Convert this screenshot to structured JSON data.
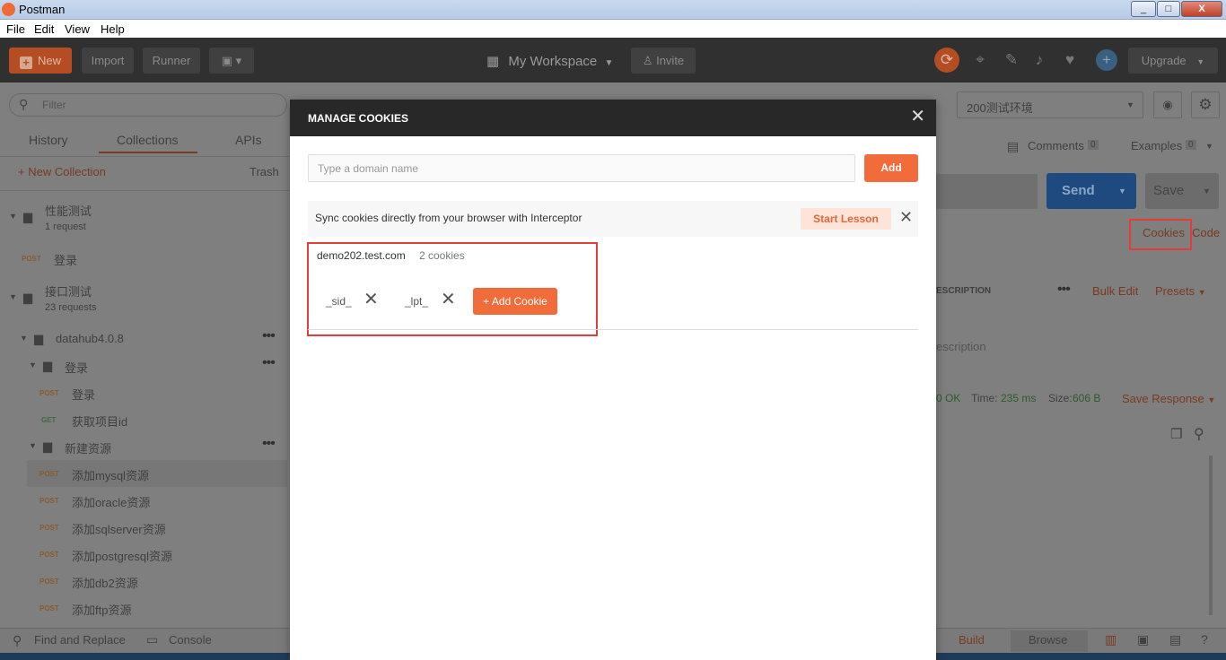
{
  "window": {
    "title": "Postman",
    "min": "_",
    "max": "□",
    "close": "X"
  },
  "menu": [
    "File",
    "Edit",
    "View",
    "Help"
  ],
  "header": {
    "new_label": "New",
    "import_label": "Import",
    "runner_label": "Runner",
    "workspace_label": "My Workspace",
    "invite_label": "Invite",
    "upgrade_label": "Upgrade"
  },
  "sidebar": {
    "filter_placeholder": "Filter",
    "tabs": [
      "History",
      "Collections",
      "APIs"
    ],
    "new_collection": "+ New Collection",
    "trash": "Trash",
    "collections": [
      {
        "name": "性能测试",
        "meta": "1 request"
      },
      {
        "name": "接口测试",
        "meta": "23 requests"
      }
    ],
    "request_post_login": {
      "method": "POST",
      "name": "登录"
    },
    "tree": {
      "root": "datahub4.0.8",
      "folder1": "登录",
      "folder2": "新建资源",
      "items": [
        {
          "method": "POST",
          "name": "登录"
        },
        {
          "method": "GET",
          "name": "获取项目id"
        },
        {
          "method": "POST",
          "name": "添加mysql资源"
        },
        {
          "method": "POST",
          "name": "添加oracle资源"
        },
        {
          "method": "POST",
          "name": "添加sqlserver资源"
        },
        {
          "method": "POST",
          "name": "添加postgresql资源"
        },
        {
          "method": "POST",
          "name": "添加db2资源"
        },
        {
          "method": "POST",
          "name": "添加ftp资源"
        }
      ]
    }
  },
  "right": {
    "environment": "200测试环境",
    "comments": "Comments",
    "comments_count": "0",
    "examples": "Examples",
    "examples_count": "0",
    "send": "Send",
    "save": "Save",
    "cookies": "Cookies",
    "code": "Code",
    "description_header": "ESCRIPTION",
    "bulk_edit": "Bulk Edit",
    "presets": "Presets",
    "description_placeholder": "escription",
    "status": "0 OK",
    "time_label": "Time:",
    "time_value": "235 ms",
    "size_label": "Size:",
    "size_value": "606 B",
    "save_response": "Save Response"
  },
  "statusbar": {
    "find_replace": "Find and Replace",
    "console": "Console",
    "build": "Build",
    "browse": "Browse"
  },
  "modal": {
    "title": "MANAGE COOKIES",
    "domain_placeholder": "Type a domain name",
    "add_label": "Add",
    "sync_text": "Sync cookies directly from your browser with Interceptor",
    "start_lesson": "Start Lesson",
    "domain": "demo202.test.com",
    "cookie_count": "2 cookies",
    "cookies": [
      "_sid_",
      "_lpt_"
    ],
    "add_cookie": "+ Add Cookie"
  }
}
